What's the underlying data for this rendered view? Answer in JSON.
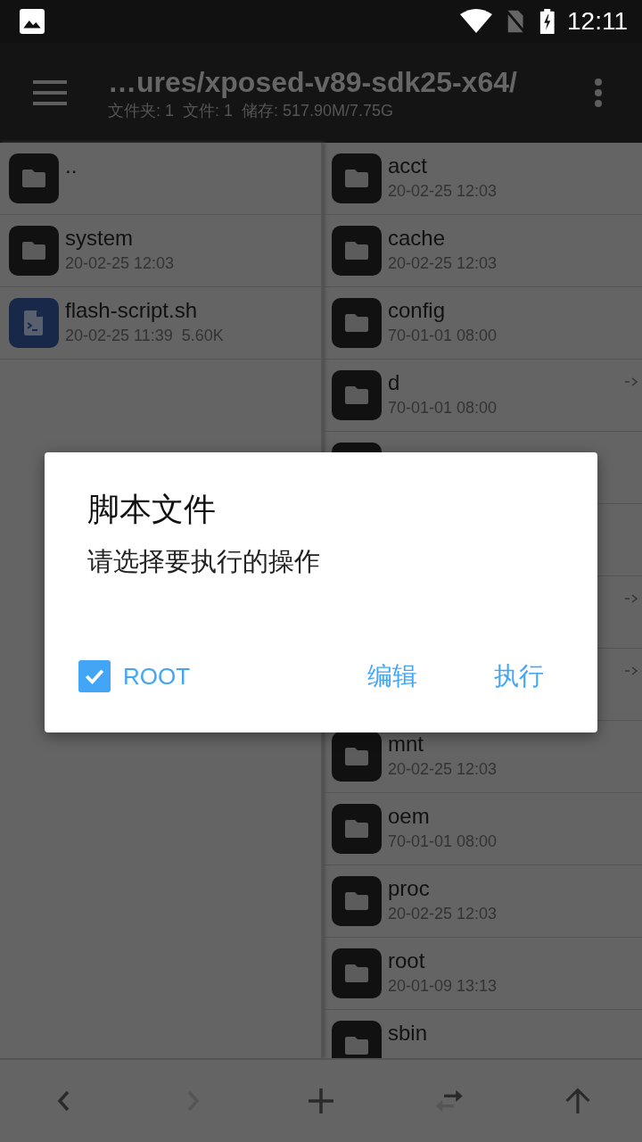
{
  "status_bar": {
    "time": "12:11"
  },
  "app_bar": {
    "title": "…ures/xposed-v89-sdk25-x64/",
    "subtitle": "文件夹: 1  文件: 1  储存: 517.90M/7.75G"
  },
  "left_pane": [
    {
      "kind": "folder",
      "name": "..",
      "link": false
    },
    {
      "kind": "folder",
      "name": "system",
      "date": "20-02-25 12:03",
      "link": false
    },
    {
      "kind": "script",
      "name": "flash-script.sh",
      "date": "20-02-25 11:39",
      "size": "5.60K",
      "link": false
    }
  ],
  "right_pane": [
    {
      "kind": "folder",
      "name": "acct",
      "date": "20-02-25 12:03",
      "link": false
    },
    {
      "kind": "folder",
      "name": "cache",
      "date": "20-02-25 12:03",
      "link": false
    },
    {
      "kind": "folder",
      "name": "config",
      "date": "70-01-01 08:00",
      "link": false
    },
    {
      "kind": "folder",
      "name": "d",
      "date": "70-01-01 08:00",
      "link": true
    },
    {
      "kind": "folder",
      "link": false
    },
    {
      "link": false
    },
    {
      "link": true
    },
    {
      "link": true
    },
    {
      "kind": "folder",
      "name": "mnt",
      "date": "20-02-25 12:03",
      "link": false
    },
    {
      "kind": "folder",
      "name": "oem",
      "date": "70-01-01 08:00",
      "link": false
    },
    {
      "kind": "folder",
      "name": "proc",
      "date": "20-02-25 12:03",
      "link": false
    },
    {
      "kind": "folder",
      "name": "root",
      "date": "20-01-09 13:13",
      "link": false
    },
    {
      "kind": "folder",
      "name": "sbin",
      "link": false
    }
  ],
  "dialog": {
    "title": "脚本文件",
    "message": "请选择要执行的操作",
    "checkbox": {
      "label": "ROOT",
      "checked": true
    },
    "buttons": [
      "编辑",
      "执行"
    ]
  },
  "bottom_bar": [
    {
      "kind": "back",
      "disabled": false
    },
    {
      "kind": "forward",
      "disabled": true
    },
    {
      "kind": "add",
      "disabled": false
    },
    {
      "kind": "swap",
      "disabled": false
    },
    {
      "kind": "up",
      "disabled": false
    }
  ]
}
